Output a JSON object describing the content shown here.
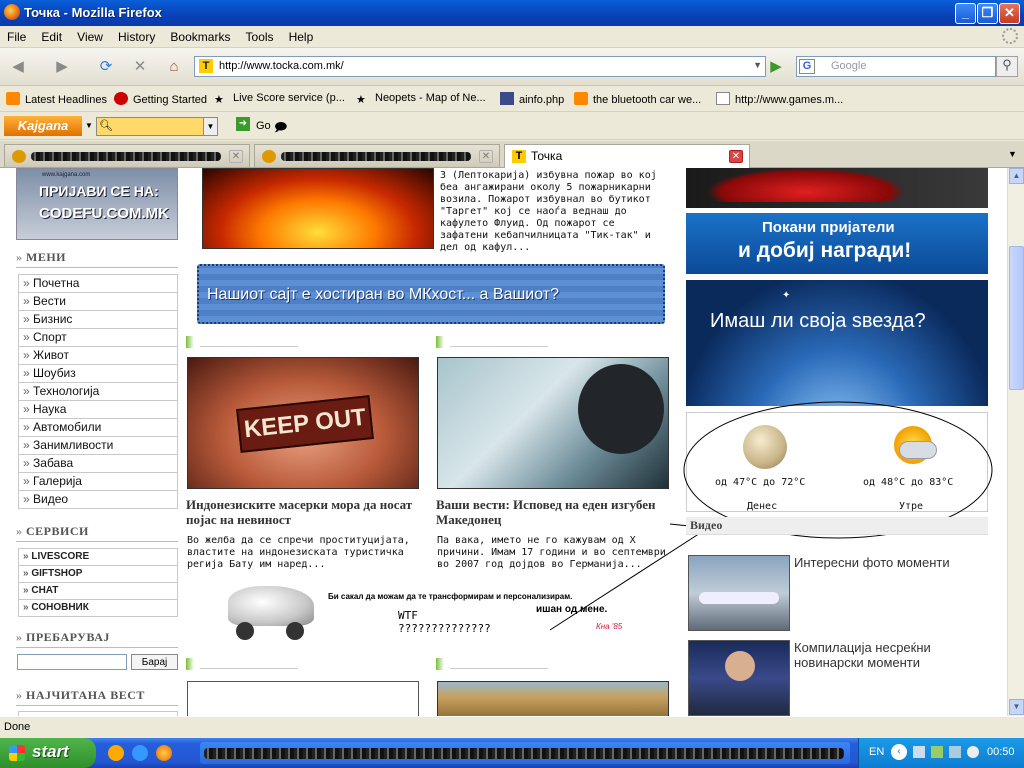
{
  "window": {
    "title": "Точка - Mozilla Firefox"
  },
  "menubar": [
    "File",
    "Edit",
    "View",
    "History",
    "Bookmarks",
    "Tools",
    "Help"
  ],
  "nav": {
    "url": "http://www.tocka.com.mk/",
    "search_placeholder": "Google",
    "go_symbol": "▶"
  },
  "bookmarks": [
    "Latest Headlines",
    "Getting Started",
    "Live Score service (p...",
    "Neopets - Map of Ne...",
    "ainfo.php",
    "the bluetooth car we...",
    "http://www.games.m..."
  ],
  "kajgana": {
    "logo": "Kajgana",
    "go_label": "Go"
  },
  "tabs": [
    {
      "label": ""
    },
    {
      "label": ""
    },
    {
      "label": "Точка"
    }
  ],
  "left": {
    "banner": {
      "line1": "ПРИЈАВИ СЕ НА:",
      "line2": "CODEFU.COM.MK",
      "small": "www.kajgana.com"
    },
    "menu_title": "МЕНИ",
    "menu_items": [
      "Почетна",
      "Вести",
      "Бизнис",
      "Спорт",
      "Живот",
      "Шоубиз",
      "Технологија",
      "Наука",
      "Автомобили",
      "Занимливости",
      "Забава",
      "Галерија",
      "Видео"
    ],
    "services_title": "СЕРВИСИ",
    "services": [
      "LIVESCORE",
      "GIFTSHOP",
      "CHAT",
      "СОНОВНИК"
    ],
    "search_title": "ПРЕБАРУВАЈ",
    "search_button": "Барај",
    "most_read_title": "НАЈЧИТАНА ВЕСТ"
  },
  "center": {
    "top_story_text": "3 (Лептокарија) избувна пожар во кој беа ангажирани околу 5 пожарникарни возила. Пожарот избувнал во бутикот \"Таргет\" кој се наоѓа веднаш до кафулето Флуид. Од пожарот се зафатени кебапчилницата \"Тик-так\" и дел од кафул...",
    "hosting_banner": "Нашиот сајт е хостиран во МКхост... а Вашиот?",
    "keep_out_text": "KEEP OUT",
    "article1": {
      "title": "Индонезиските масерки мора да носат појас на невиност",
      "text": "Во желба да се спречи проституцијата, властите на индонезиската туристичка регија Бату им наред..."
    },
    "article2": {
      "title": "Ваши вести: Исповед на еден изгубен Македонец",
      "text": "Па вака, името не го кажувам од X причини. Имам 17 години и во септември во 2007 год дојдов во Германија..."
    },
    "car_ad": {
      "line1": "Би сакал да можам да те трансформирам и персонализирам.",
      "line2": "ишан од мене.",
      "sig": "Кна '85"
    },
    "annotation": "WTF\n??????????????"
  },
  "right": {
    "invite": {
      "line1": "Покани пријатели",
      "line2": "и добиј награди!"
    },
    "star_ad": "Имаш ли своја ѕвезда?",
    "weather": [
      {
        "range": "од 47°C до 72°C",
        "day": "Денес",
        "icon": "moon-icon"
      },
      {
        "range": "од 48°C до 83°C",
        "day": "Утре",
        "icon": "sun-cloud-icon"
      }
    ],
    "video_title": "Видео",
    "videos": [
      {
        "title": "Интересни фото моменти"
      },
      {
        "title": "Компилација несреќни новинарски моменти"
      }
    ]
  },
  "status": {
    "text": "Done"
  },
  "taskbar": {
    "start": "start",
    "lang": "EN",
    "clock": "00:50"
  },
  "colors": {
    "xp_blue": "#0a5fd8",
    "kajgana_orange": "#f08a10",
    "accent_green": "#7bbf3a"
  }
}
